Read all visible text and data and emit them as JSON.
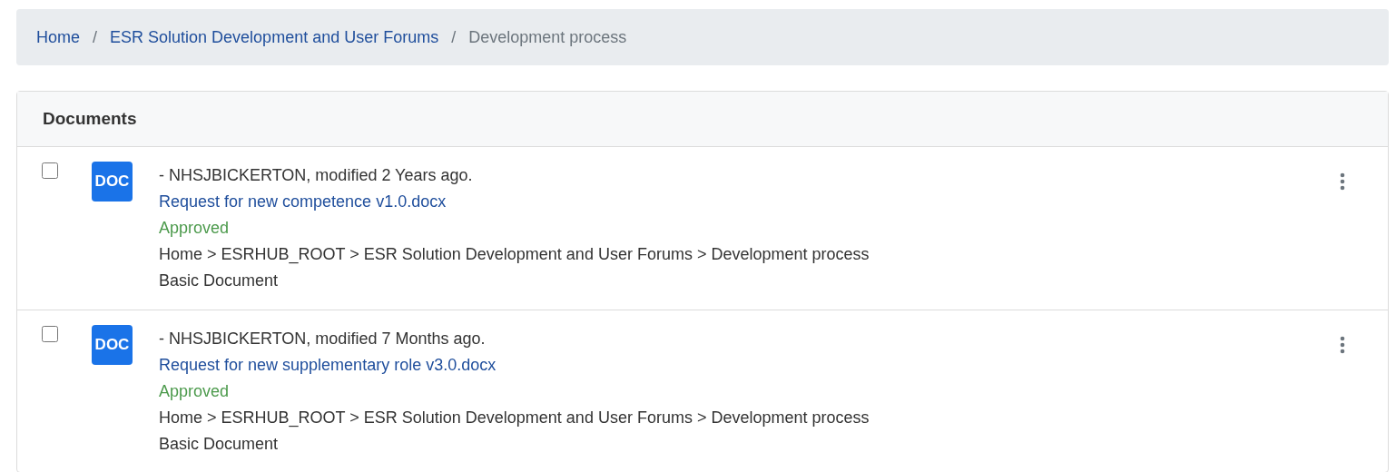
{
  "breadcrumb_separator": "/",
  "breadcrumb": [
    {
      "label": "Home",
      "current": false
    },
    {
      "label": "ESR Solution Development and User Forums",
      "current": false
    },
    {
      "label": "Development process",
      "current": true
    }
  ],
  "documents": {
    "title": "Documents",
    "items": [
      {
        "checked": false,
        "icon": "DOC",
        "meta": "- NHSJBICKERTON, modified 2 Years ago.",
        "name": "Request for new competence v1.0.docx",
        "status": "Approved",
        "path": "Home > ESRHUB_ROOT > ESR Solution Development and User Forums > Development process",
        "type": "Basic Document"
      },
      {
        "checked": false,
        "icon": "DOC",
        "meta": "- NHSJBICKERTON, modified 7 Months ago.",
        "name": "Request for new supplementary role v3.0.docx",
        "status": "Approved",
        "path": "Home > ESRHUB_ROOT > ESR Solution Development and User Forums > Development process",
        "type": "Basic Document"
      }
    ]
  }
}
